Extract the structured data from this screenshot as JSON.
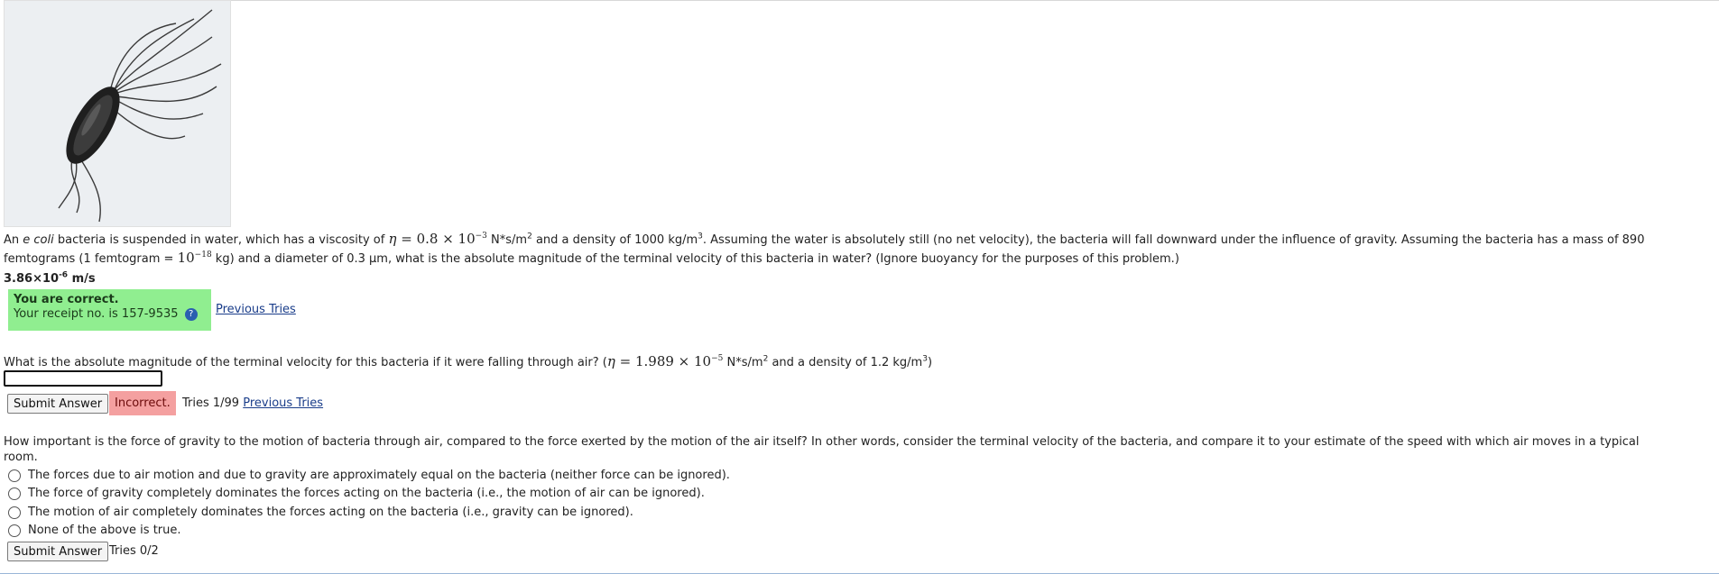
{
  "question1": {
    "line1": "An e coli bacteria is suspended in water, which has a viscosity of η = 0.8 × 10⁻³ N*s/m² and a density of 1000 kg/m³. Assuming the water is absolutely still (no net velocity), the bacteria will fall downward under the influence of gravity. Assuming the bacteria has a mass of 890",
    "line2": "femtograms (1 femtogram = 10⁻¹⁸ kg) and a diameter of 0.3 μm, what is the absolute magnitude of the terminal velocity of this bacteria in water? (Ignore buoyancy for the purposes of this problem.)",
    "answer": "3.86×10⁻⁶ m/s",
    "status_title": "You are correct.",
    "receipt": "Your receipt no. is 157-9535",
    "help_icon": "?",
    "previous_tries": "Previous Tries"
  },
  "question2": {
    "text": "What is the absolute magnitude of the terminal velocity for this bacteria if it were falling through air? (η = 1.989 × 10⁻⁵ N*s/m² and a density of 1.2 kg/m³)",
    "input_value": "",
    "submit_label": "Submit Answer",
    "status": "Incorrect.",
    "tries": "Tries 1/99",
    "previous_tries": "Previous Tries"
  },
  "question3": {
    "line1": "How important is the force of gravity to the motion of bacteria through air, compared to the force exerted by the motion of the air itself? In other words, consider the terminal velocity of the bacteria, and compare it to your estimate of the speed with which air moves in a typical",
    "line2": "room.",
    "options": [
      "The forces due to air motion and due to gravity are approximately equal on the bacteria (neither force can be ignored).",
      "The force of gravity completely dominates the forces acting on the bacteria (i.e., the motion of air can be ignored).",
      "The motion of air completely dominates the forces acting on the bacteria (i.e., gravity can be ignored).",
      "None of the above is true."
    ],
    "submit_label": "Submit Answer",
    "tries": "Tries 0/2"
  },
  "colors": {
    "correct_bg": "#90ee90",
    "incorrect_bg": "#f4a0a0",
    "link": "#1a3d8a"
  }
}
